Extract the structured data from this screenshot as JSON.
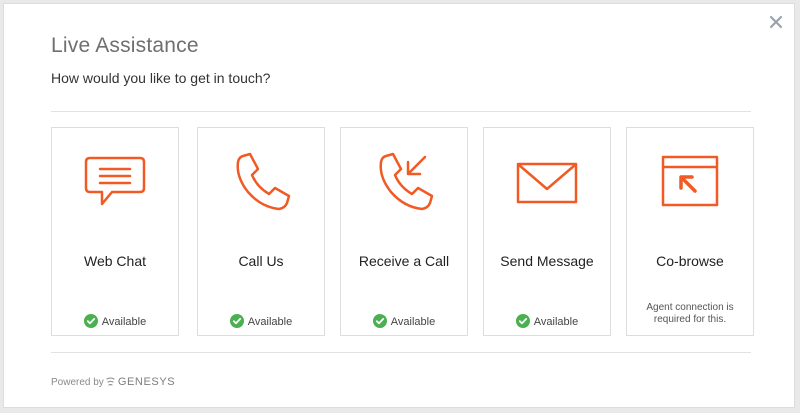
{
  "dialog": {
    "title": "Live Assistance",
    "subtitle": "How would you like to get in touch?",
    "close_icon": "close-icon"
  },
  "options": [
    {
      "label": "Web Chat",
      "icon": "chat-bubble-icon",
      "status": "Available",
      "available": true
    },
    {
      "label": "Call Us",
      "icon": "phone-icon",
      "status": "Available",
      "available": true
    },
    {
      "label": "Receive a Call",
      "icon": "phone-incoming-icon",
      "status": "Available",
      "available": true
    },
    {
      "label": "Send Message",
      "icon": "envelope-icon",
      "status": "Available",
      "available": true
    },
    {
      "label": "Co-browse",
      "icon": "cobrowse-icon",
      "note": "Agent connection is required for this.",
      "available": false
    }
  ],
  "footer": {
    "powered_by": "Powered by",
    "brand": "GENESYS"
  },
  "colors": {
    "accent": "#f15a24",
    "available_green": "#4caf50"
  }
}
